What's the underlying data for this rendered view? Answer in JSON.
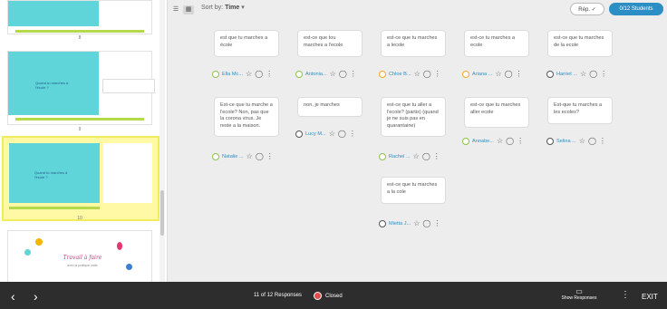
{
  "toolbar": {
    "sort_label": "Sort by:",
    "sort_value": "Time",
    "reply_button": "Rép.",
    "students_button": "0/12 Students"
  },
  "slides": [
    {
      "num": "8"
    },
    {
      "num": "9",
      "question": "Quand tu marches à l'école ?"
    },
    {
      "num": "10",
      "question": "Quand tu marches à l'école ?",
      "selected": true
    },
    {
      "num": "11",
      "title": "Travail à faire",
      "subtitle": "avec la pratique orale"
    }
  ],
  "responses": [
    {
      "text": "est que tu marches a école",
      "name": "Ella Mc...",
      "emoji_color": "#8bc34a"
    },
    {
      "text": "est-ce que tou marches a l'ecole",
      "name": "Antonia...",
      "emoji_color": "#8bc34a"
    },
    {
      "text": "est-ce que tu marches a lecole",
      "name": "Chloe B...",
      "emoji_color": "#f5a623"
    },
    {
      "text": "est-ce tu marches a ecole",
      "name": "Ariana ...",
      "emoji_color": "#f5a623"
    },
    {
      "text": "est-ce que tu marches de la ecole",
      "name": "Harriet ...",
      "emoji_color": "#555555"
    },
    {
      "text": "Est-ce que tu marche a l'ecole? Non, pas que la corona virus. Je reste a la maison.",
      "name": "Natalie ...",
      "emoji_color": "#8bc34a"
    },
    {
      "text": "non, je marches",
      "name": "Lucy M...",
      "emoji_color": "#555555"
    },
    {
      "text": "est-ce que tu aller a l'ecole? (partis) (quand je ne suis pas en quarantaine)",
      "name": "Rachel ...",
      "emoji_color": "#8bc34a"
    },
    {
      "text": "est-ce que tu marches aller ecole",
      "name": "Annabe...",
      "emoji_color": "#8bc34a"
    },
    {
      "text": "Est-que tu marches a les ecoles?",
      "name": "Selina ...",
      "emoji_color": "#555555"
    },
    {
      "text": "est-ce que tu marches a la cole",
      "name": "Mietta J...",
      "emoji_color": "#555555"
    }
  ],
  "footer": {
    "responses_count": "11 of 12 Responses",
    "status": "Closed",
    "show_responses": "Show Responses",
    "exit": "EXIT"
  },
  "colors": {
    "accent": "#2b8fc4",
    "closed_red": "#e24b4b",
    "selected_slide": "#fff9a6"
  }
}
